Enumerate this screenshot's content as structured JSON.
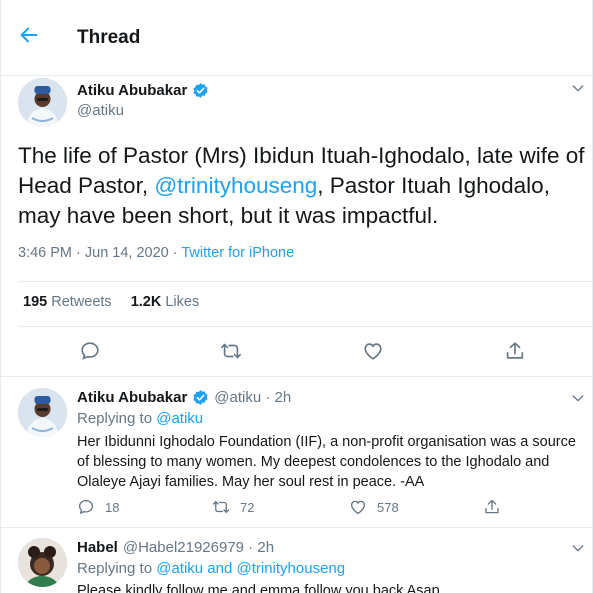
{
  "header": {
    "title": "Thread"
  },
  "main_tweet": {
    "display_name": "Atiku Abubakar",
    "handle": "@atiku",
    "text_part1": "The life of Pastor (Mrs) Ibidun Ituah-Ighodalo, late wife of Head Pastor, ",
    "text_mention": "@trinityhouseng",
    "text_part2": ", Pastor Ituah Ighodalo, may have been short, but it was impactful.",
    "time": "3:46 PM · Jun 14, 2020 · ",
    "source": "Twitter for iPhone",
    "retweets_count": "195",
    "retweets_label": "Retweets",
    "likes_count": "1.2K",
    "likes_label": "Likes"
  },
  "reply1": {
    "display_name": "Atiku Abubakar",
    "handle_time": "@atiku · 2h",
    "replying_label": "Replying to ",
    "replying_to": "@atiku",
    "text": "Her Ibidunni Ighodalo Foundation (IIF), a non-profit organisation was a source of blessing to many women. My deepest condolences to the Ighodalo and Olaleye Ajayi families. May her soul rest in peace. -AA",
    "reply_count": "18",
    "retweet_count": "72",
    "like_count": "578"
  },
  "reply2": {
    "display_name": "Habel",
    "handle_time": "@Habel21926979 · 2h",
    "replying_label": "Replying to ",
    "replying_to": "@atiku and @trinityhouseng",
    "text_partial": "Please kindly follow me and emma follow you back Asap"
  },
  "colors": {
    "accent": "#1da1f2",
    "text": "#14171a",
    "secondary": "#657786",
    "divider": "#e6ecf0"
  },
  "icons": {
    "back": "arrow-left-icon",
    "verified": "verified-badge-icon",
    "caret": "chevron-down-icon",
    "reply": "reply-icon",
    "retweet": "retweet-icon",
    "like": "heart-icon",
    "share": "share-icon"
  }
}
